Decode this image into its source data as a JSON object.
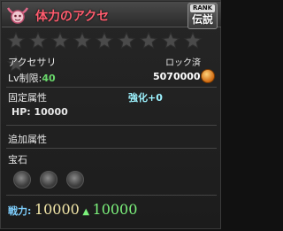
{
  "item": {
    "name": "体力のアクセ",
    "rank_label": "RANK",
    "rank_value": "伝説",
    "stars_total": 10,
    "stars_filled": 0,
    "type": "アクセサリ",
    "lock_status": "ロック済",
    "level_label": "Lv制限:",
    "level_value": "40",
    "price": "5070000",
    "fixed_attr_label": "固定属性",
    "enhance": "強化+0",
    "hp": "HP: 10000",
    "extra_attr_label": "追加属性",
    "gem_label": "宝石",
    "gem_slots": 3,
    "power_label": "戦力:",
    "power_value": "10000",
    "power_new": "10000"
  },
  "colors": {
    "title": "#ff5c6e",
    "level": "#69d86b",
    "enhance": "#9df3ff",
    "power_up": "#7cf27c"
  },
  "icons": [
    "horned-emblem-icon",
    "star-icon",
    "gold-coin-icon",
    "gem-slot-icon",
    "up-arrow-icon"
  ]
}
